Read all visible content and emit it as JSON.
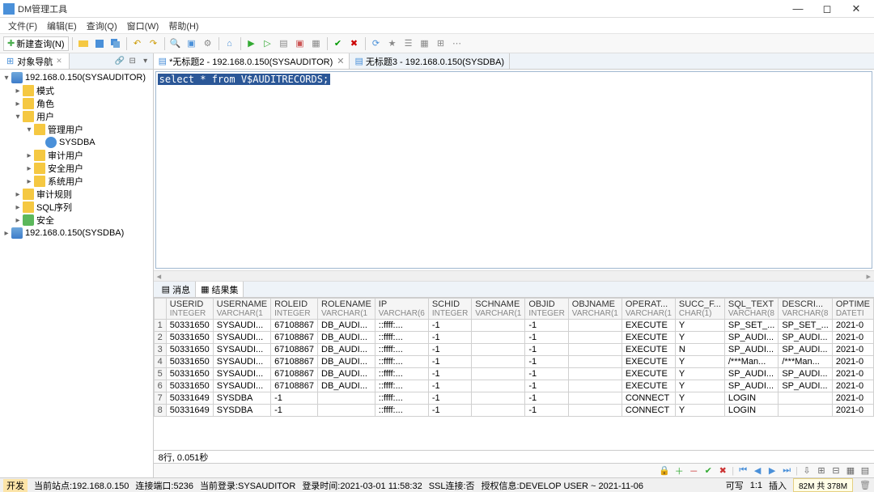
{
  "window": {
    "title": "DM管理工具"
  },
  "menu": {
    "file": "文件(F)",
    "edit": "编辑(E)",
    "query": "查询(Q)",
    "window": "窗口(W)",
    "help": "帮助(H)"
  },
  "toolbar": {
    "newQuery": "新建查询(N)"
  },
  "sidebar": {
    "panelTitle": "对象导航",
    "root1": "192.168.0.150(SYSAUDITOR)",
    "n_mode": "模式",
    "n_role": "角色",
    "n_user": "用户",
    "n_mgmt": "管理用户",
    "n_sysdba": "SYSDBA",
    "n_audit": "审计用户",
    "n_sec": "安全用户",
    "n_sys": "系统用户",
    "n_rule": "审计规则",
    "n_sql": "SQL序列",
    "n_safe": "安全",
    "root2": "192.168.0.150(SYSDBA)"
  },
  "tabs": {
    "t1": "*无标题2 - 192.168.0.150(SYSAUDITOR)",
    "t2": "无标题3 - 192.168.0.150(SYSDBA)"
  },
  "sql": {
    "text": "select * from V$AUDITRECORDS;"
  },
  "resultTabs": {
    "msg": "消息",
    "rs": "结果集"
  },
  "columns": [
    {
      "name": "USERID",
      "type": "INTEGER"
    },
    {
      "name": "USERNAME",
      "type": "VARCHAR(1"
    },
    {
      "name": "ROLEID",
      "type": "INTEGER"
    },
    {
      "name": "ROLENAME",
      "type": "VARCHAR(1"
    },
    {
      "name": "IP",
      "type": "VARCHAR(6"
    },
    {
      "name": "SCHID",
      "type": "INTEGER"
    },
    {
      "name": "SCHNAME",
      "type": "VARCHAR(1"
    },
    {
      "name": "OBJID",
      "type": "INTEGER"
    },
    {
      "name": "OBJNAME",
      "type": "VARCHAR(1"
    },
    {
      "name": "OPERAT...",
      "type": "VARCHAR(1"
    },
    {
      "name": "SUCC_F...",
      "type": "CHAR(1)"
    },
    {
      "name": "SQL_TEXT",
      "type": "VARCHAR(8"
    },
    {
      "name": "DESCRI...",
      "type": "VARCHAR(8"
    },
    {
      "name": "OPTIME",
      "type": "DATETI"
    }
  ],
  "rows": [
    [
      "50331650",
      "SYSAUDI...",
      "67108867",
      "DB_AUDI...",
      "::ffff:...",
      "-1",
      "",
      "-1",
      "",
      "EXECUTE",
      "Y",
      "SP_SET_...",
      "SP_SET_...",
      "2021-0"
    ],
    [
      "50331650",
      "SYSAUDI...",
      "67108867",
      "DB_AUDI...",
      "::ffff:...",
      "-1",
      "",
      "-1",
      "",
      "EXECUTE",
      "Y",
      "SP_AUDI...",
      "SP_AUDI...",
      "2021-0"
    ],
    [
      "50331650",
      "SYSAUDI...",
      "67108867",
      "DB_AUDI...",
      "::ffff:...",
      "-1",
      "",
      "-1",
      "",
      "EXECUTE",
      "N",
      "SP_AUDI...",
      "SP_AUDI...",
      "2021-0"
    ],
    [
      "50331650",
      "SYSAUDI...",
      "67108867",
      "DB_AUDI...",
      "::ffff:...",
      "-1",
      "",
      "-1",
      "",
      "EXECUTE",
      "Y",
      "/***Man...",
      "/***Man...",
      "2021-0"
    ],
    [
      "50331650",
      "SYSAUDI...",
      "67108867",
      "DB_AUDI...",
      "::ffff:...",
      "-1",
      "",
      "-1",
      "",
      "EXECUTE",
      "Y",
      "SP_AUDI...",
      "SP_AUDI...",
      "2021-0"
    ],
    [
      "50331650",
      "SYSAUDI...",
      "67108867",
      "DB_AUDI...",
      "::ffff:...",
      "-1",
      "",
      "-1",
      "",
      "EXECUTE",
      "Y",
      "SP_AUDI...",
      "SP_AUDI...",
      "2021-0"
    ],
    [
      "50331649",
      "SYSDBA",
      "-1",
      "",
      "::ffff:...",
      "-1",
      "",
      "-1",
      "",
      "CONNECT",
      "Y",
      "LOGIN",
      "",
      "2021-0"
    ],
    [
      "50331649",
      "SYSDBA",
      "-1",
      "",
      "::ffff:...",
      "-1",
      "",
      "-1",
      "",
      "CONNECT",
      "Y",
      "LOGIN",
      "",
      "2021-0"
    ]
  ],
  "footer": {
    "rows": "8行, 0.051秒"
  },
  "status": {
    "dev": "开发",
    "site": "当前站点:192.168.0.150",
    "port": "连接端口:5236",
    "login": "当前登录:SYSAUDITOR",
    "time": "登录时间:2021-03-01 11:58:32",
    "ssl": "SSL连接:否",
    "auth": "授权信息:DEVELOP USER ~ 2021-11-06",
    "rw": "可写",
    "pos": "1:1",
    "ins": "插入",
    "mem": "82M 共 378M"
  }
}
